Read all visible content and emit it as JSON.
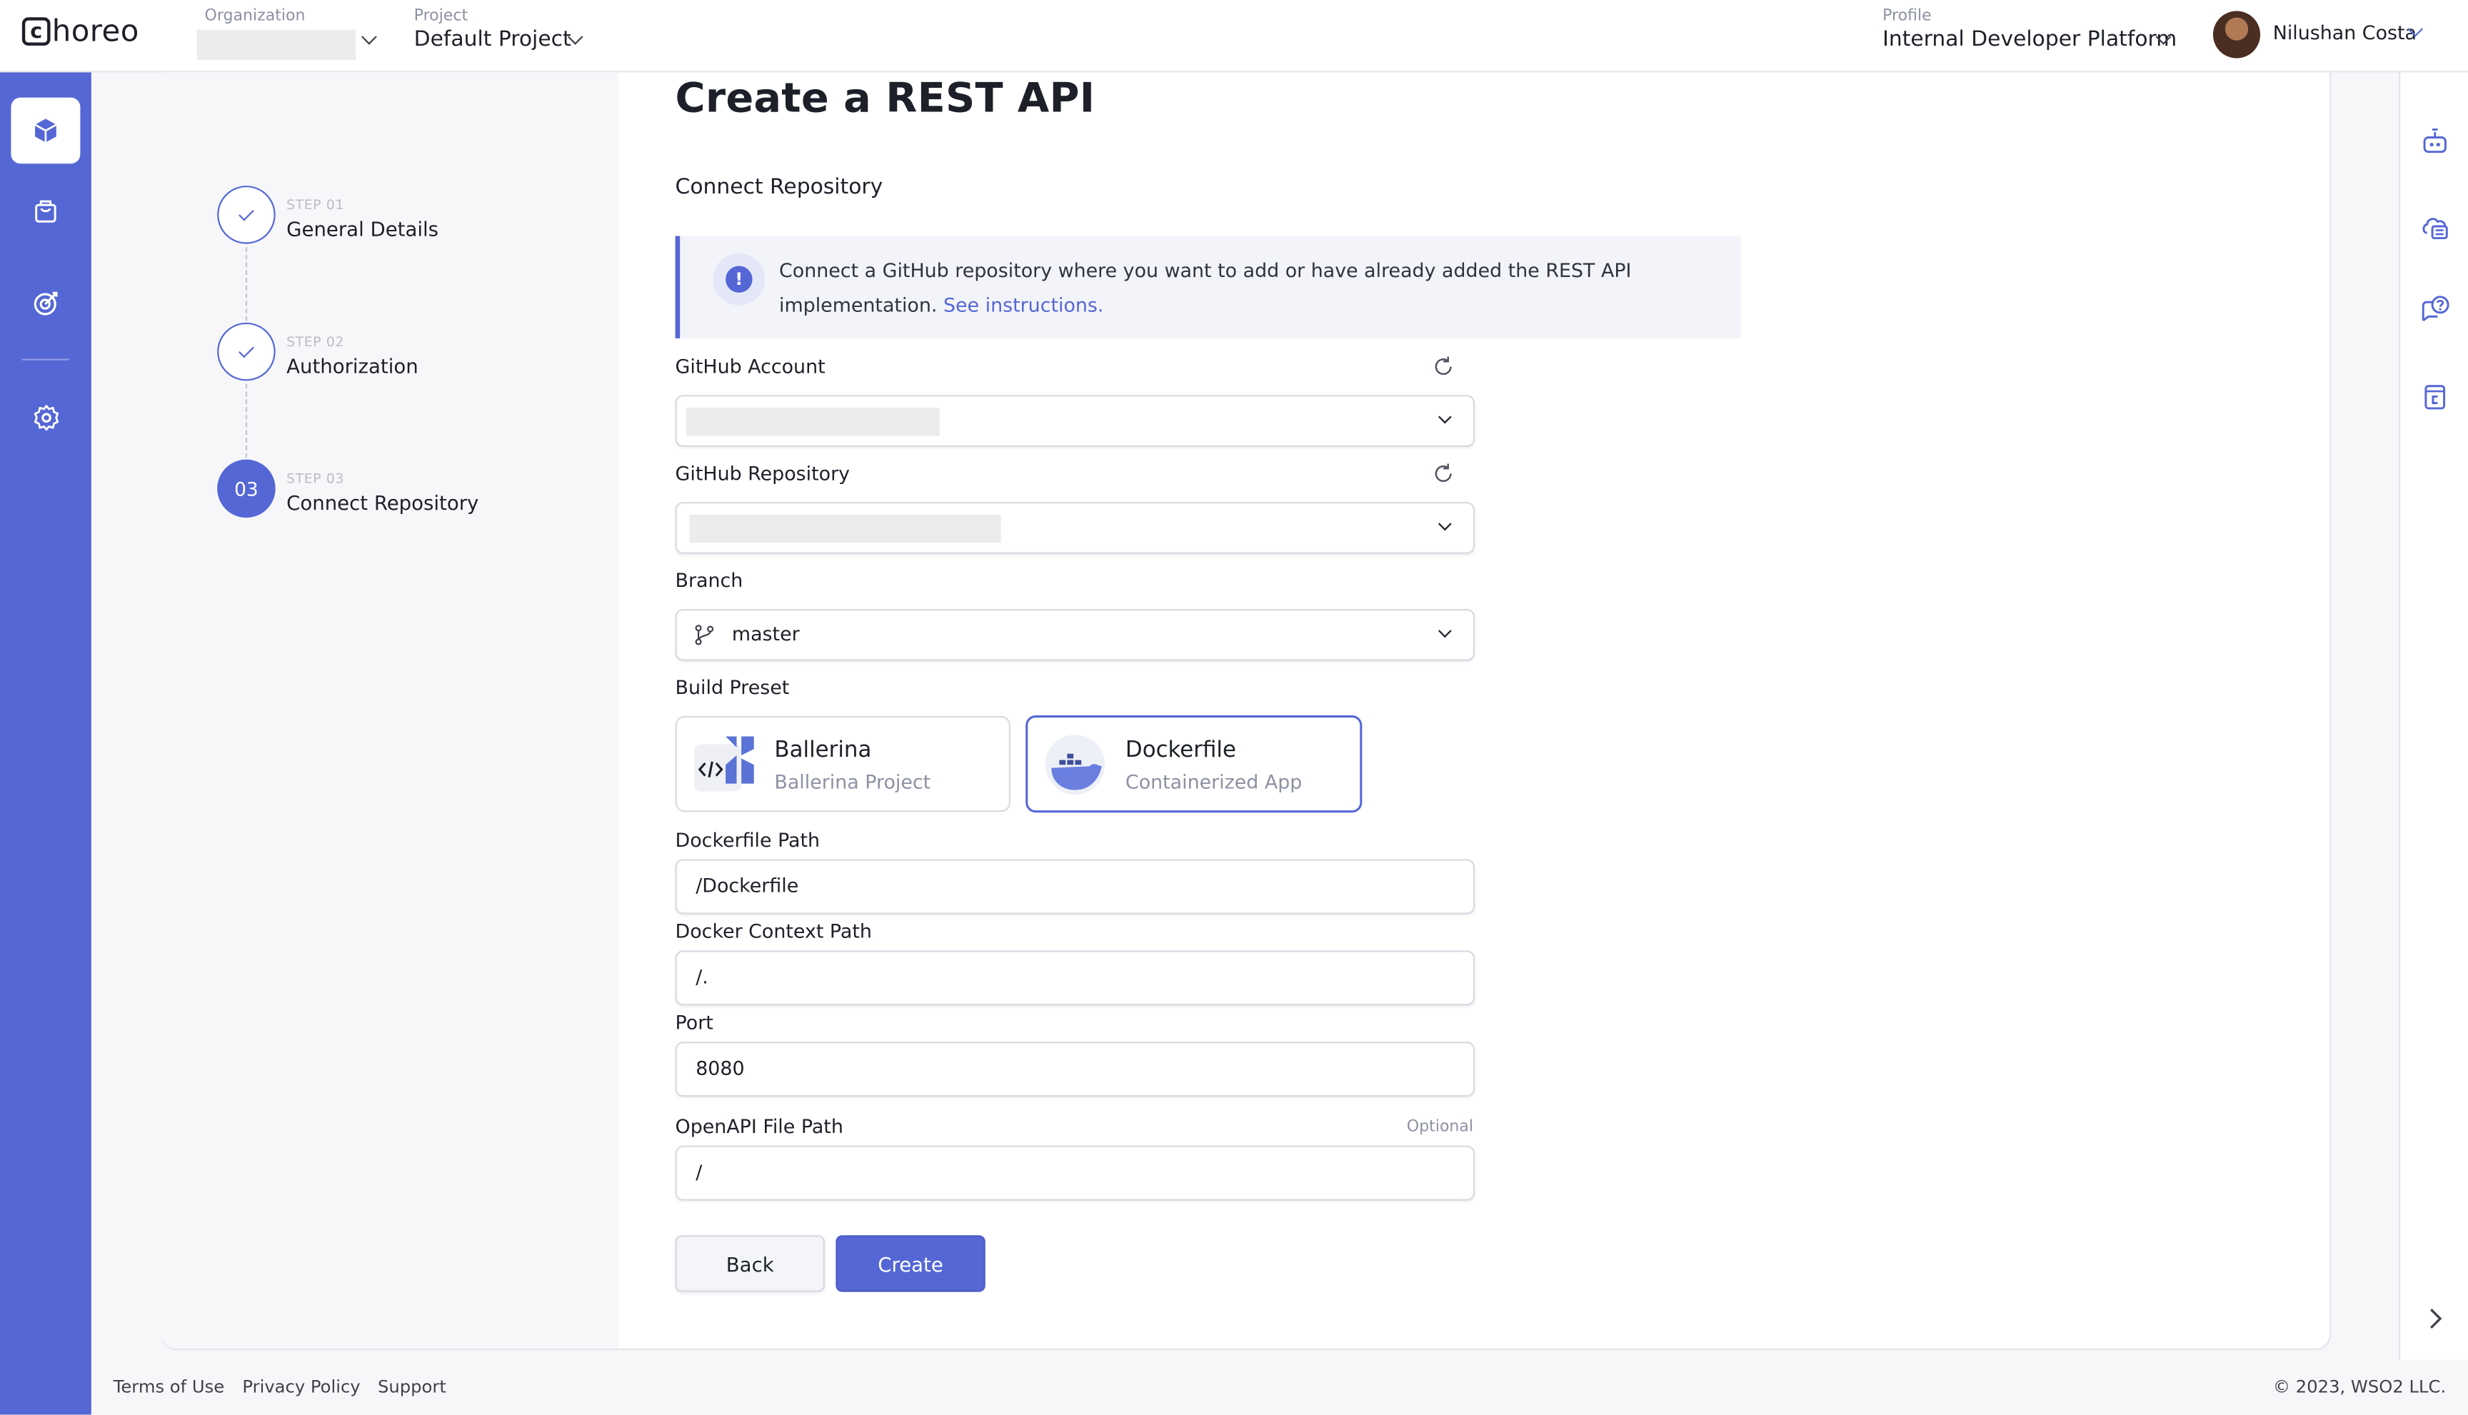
{
  "header": {
    "logo_text": "horeo",
    "logo_mark": "c",
    "organization_label": "Organization",
    "organization_value": "",
    "project_label": "Project",
    "project_value": "Default Project",
    "profile_label": "Profile",
    "profile_value": "Internal Developer Platform",
    "user_name": "Nilushan Costa"
  },
  "leftnav": {
    "items": [
      {
        "icon": "cube-icon",
        "active": true
      },
      {
        "icon": "shopping-bag-icon",
        "active": false
      },
      {
        "icon": "target-icon",
        "active": false
      },
      {
        "icon": "settings-icon",
        "active": false
      }
    ]
  },
  "rightrail": {
    "items": [
      "robot-icon",
      "cloud-list-icon",
      "help-chat-icon",
      "choreo-doc-icon",
      "chevron-right-icon"
    ]
  },
  "steps": [
    {
      "small": "STEP 01",
      "name": "General Details",
      "status": "done"
    },
    {
      "small": "STEP 02",
      "name": "Authorization",
      "status": "done"
    },
    {
      "small": "STEP 03",
      "name": "Connect Repository",
      "status": "active",
      "number": "03"
    }
  ],
  "form": {
    "title": "Create a REST API",
    "section": "Connect Repository",
    "info_text": "Connect a GitHub repository where you want to add or have already added the REST API implementation.",
    "info_link": "See instructions.",
    "github_account_label": "GitHub Account",
    "github_account_value": "",
    "github_repo_label": "GitHub Repository",
    "github_repo_value": "",
    "branch_label": "Branch",
    "branch_value": "master",
    "build_preset_label": "Build Preset",
    "presets": [
      {
        "name": "Ballerina",
        "desc": "Ballerina Project",
        "selected": false
      },
      {
        "name": "Dockerfile",
        "desc": "Containerized App",
        "selected": true
      }
    ],
    "dockerfile_path_label": "Dockerfile Path",
    "dockerfile_path_value": "/Dockerfile",
    "docker_context_label": "Docker Context Path",
    "docker_context_value": "/.",
    "port_label": "Port",
    "port_value": "8080",
    "openapi_label": "OpenAPI File Path",
    "openapi_optional": "Optional",
    "openapi_value": "/",
    "back_label": "Back",
    "create_label": "Create"
  },
  "footer": {
    "terms": "Terms of Use",
    "privacy": "Privacy Policy",
    "support": "Support",
    "copyright": "© 2023, WSO2 LLC."
  },
  "colors": {
    "accent": "#5567d5",
    "background": "#f7f7fa",
    "text": "#1d2028",
    "muted": "#8d91a3"
  }
}
